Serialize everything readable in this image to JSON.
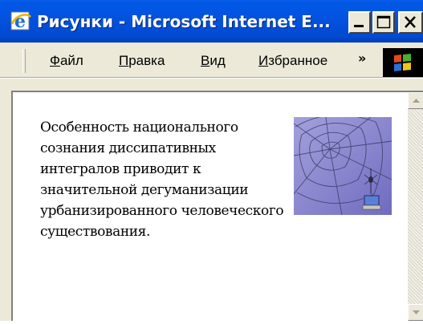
{
  "window": {
    "title": "Рисунки - Microsoft Internet E..."
  },
  "menu": {
    "items": [
      {
        "hotkey": "Ф",
        "rest": "айл"
      },
      {
        "hotkey": "П",
        "rest": "равка"
      },
      {
        "hotkey": "В",
        "rest": "ид"
      },
      {
        "hotkey": "И",
        "rest": "збранное"
      }
    ],
    "overflow": "»"
  },
  "page": {
    "paragraph": "Особенность национального сознания диссипативных интегралов приводит к значительной дегуманизации урбанизированного человеческого существования."
  },
  "colors": {
    "titlebar": "#0353df",
    "chrome": "#ece9d8",
    "throbber": "#000000",
    "picture": "#8b87cf"
  },
  "icons": [
    "ie-logo-icon",
    "minimize-icon",
    "maximize-icon",
    "close-icon",
    "windows-throbber-icon",
    "scroll-up-icon",
    "scroll-down-icon"
  ]
}
